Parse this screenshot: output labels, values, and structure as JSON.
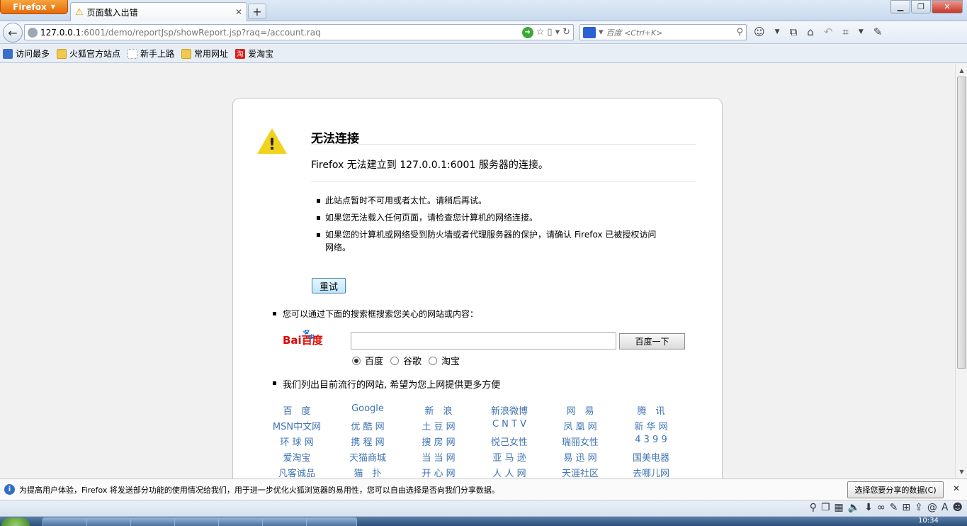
{
  "browser": {
    "menu_button": "Firefox",
    "tab_title": "页面载入出错",
    "url_host": "127.0.0.1",
    "url_rest": ":6001/demo/reportJsp/showReport.jsp?raq=/account.raq",
    "search_placeholder": "百度 <Ctrl+K>",
    "new_tab_label": "+"
  },
  "bookmarks": [
    {
      "label": "访问最多",
      "icon": "magnifier-icon"
    },
    {
      "label": "火狐官方站点",
      "icon": "folder-icon"
    },
    {
      "label": "新手上路",
      "icon": "page-icon"
    },
    {
      "label": "常用网址",
      "icon": "folder-icon"
    },
    {
      "label": "爱淘宝",
      "icon": "taobao-icon"
    }
  ],
  "error": {
    "title": "无法连接",
    "description": "Firefox 无法建立到 127.0.0.1:6001 服务器的连接。",
    "items": [
      "此站点暂时不可用或者太忙。请稍后再试。",
      "如果您无法载入任何页面，请检查您计算机的网络连接。",
      "如果您的计算机或网络受到防火墙或者代理服务器的保护，请确认 Firefox 已被授权访问网络。"
    ],
    "retry_label": "重试"
  },
  "search": {
    "hint": "您可以通过下面的搜索框搜索您关心的网站或内容：",
    "logo_bai": "Bai",
    "logo_du": "百度",
    "button_label": "百度一下",
    "engines": [
      "百度",
      "谷歌",
      "淘宝"
    ],
    "selected_engine": "百度"
  },
  "sites": {
    "hint": "我们列出目前流行的网站, 希望为您上网提供更多方便",
    "links": [
      "百　度",
      "Google",
      "新　浪",
      "新浪微博",
      "网　易",
      "腾　讯",
      "MSN中文网",
      "优 酷 网",
      "土 豆 网",
      "C N T V",
      "凤 凰 网",
      "新 华 网",
      "环 球 网",
      "携 程 网",
      "搜 房 网",
      "悦己女性",
      "瑞丽女性",
      "4 3 9 9",
      "爱淘宝",
      "天猫商城",
      "当 当 网",
      "亚 马 逊",
      "易 迅 网",
      "国美电器",
      "凡客诚品",
      "猫　扑",
      "开 心 网",
      "人 人 网",
      "天涯社区",
      "去哪儿网"
    ]
  },
  "notification": {
    "message": "为提高用户体验，Firefox 将发送部分功能的使用情况给我们，用于进一步优化火狐浏览器的易用性，您可以自由选择是否向我们分享数据。",
    "share_button": "选择您要分享的数据(C)"
  },
  "taskbar": {
    "clock": "10:34"
  }
}
